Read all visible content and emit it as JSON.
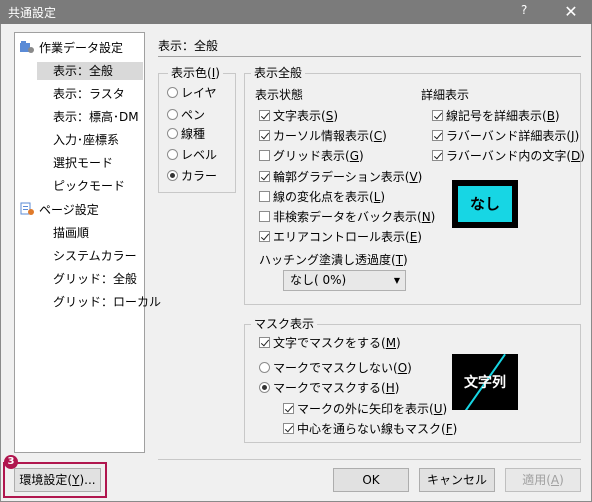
{
  "window": {
    "title": "共通設定",
    "help": "?",
    "close": "✕"
  },
  "tree": {
    "items": [
      {
        "label": "作業データ設定",
        "group": true
      },
      {
        "label": "表示：全般",
        "selected": true
      },
      {
        "label": "表示：ラスタ"
      },
      {
        "label": "表示：標高･DM"
      },
      {
        "label": "入力･座標系"
      },
      {
        "label": "選択モード"
      },
      {
        "label": "ピックモード"
      },
      {
        "label": "ページ設定",
        "group": true
      },
      {
        "label": "描画順"
      },
      {
        "label": "システムカラー"
      },
      {
        "label": "グリッド：全般"
      },
      {
        "label": "グリッド：ローカル"
      }
    ]
  },
  "section_title": "表示：全般",
  "display_color": {
    "label_pre": "表示色(",
    "label_key": "I",
    "label_post": ")",
    "options": [
      {
        "label": "レイヤ",
        "checked": false
      },
      {
        "label": "ペン",
        "checked": false
      },
      {
        "label": "線種",
        "checked": false
      },
      {
        "label": "レベル",
        "checked": false
      },
      {
        "label": "カラー",
        "checked": true
      }
    ]
  },
  "general": {
    "label": "表示全般",
    "state_label": "表示状態",
    "detail_label": "詳細表示",
    "state_checks": [
      {
        "text": "文字表示(",
        "key": "S",
        "post": ")",
        "checked": true
      },
      {
        "text": "カーソル情報表示(",
        "key": "C",
        "post": ")",
        "checked": true
      },
      {
        "text": "グリッド表示(",
        "key": "G",
        "post": ")",
        "checked": false
      },
      {
        "text": "輪郭グラデーション表示(",
        "key": "V",
        "post": ")",
        "checked": true
      },
      {
        "text": "線の変化点を表示(",
        "key": "L",
        "post": ")",
        "checked": false
      },
      {
        "text": "非検索データをバック表示(",
        "key": "N",
        "post": ")",
        "checked": false
      },
      {
        "text": "エリアコントロール表示(",
        "key": "E",
        "post": ")",
        "checked": true
      }
    ],
    "detail_checks": [
      {
        "text": "線記号を詳細表示(",
        "key": "B",
        "post": ")",
        "checked": true
      },
      {
        "text": "ラバーバンド詳細表示(",
        "key": "J",
        "post": ")",
        "checked": true
      },
      {
        "text": "ラバーバンド内の文字(",
        "key": "D",
        "post": ")",
        "checked": true
      }
    ],
    "hatch_label_pre": "ハッチング塗潰し透過度(",
    "hatch_key": "T",
    "hatch_label_post": ")",
    "hatch_value": "なし( 0%)",
    "preview_text": "なし"
  },
  "mask": {
    "label": "マスク表示",
    "mask_check": {
      "text": "文字でマスクをする(",
      "key": "M",
      "post": ")",
      "checked": true
    },
    "radio_no": {
      "text": "マークでマスクしない(",
      "key": "O",
      "post": ")",
      "checked": false
    },
    "radio_yes": {
      "text": "マークでマスクする(",
      "key": "H",
      "post": ")",
      "checked": true
    },
    "sub_checks": [
      {
        "text": "マークの外に矢印を表示(",
        "key": "U",
        "post": ")",
        "checked": true
      },
      {
        "text": "中心を通らない線もマスク(",
        "key": "F",
        "post": ")",
        "checked": true
      }
    ],
    "preview_text": "文字列"
  },
  "buttons": {
    "env_pre": "環境設定(",
    "env_key": "Y",
    "env_post": ")...",
    "ok": "OK",
    "cancel": "キャンセル",
    "apply_pre": "適用(",
    "apply_key": "A",
    "apply_post": ")"
  },
  "callout": {
    "number": "3",
    "color": "#b0164e"
  },
  "colors": {
    "preview_cyan": "#17d6e4",
    "titlebar": "#7b7b7b"
  }
}
